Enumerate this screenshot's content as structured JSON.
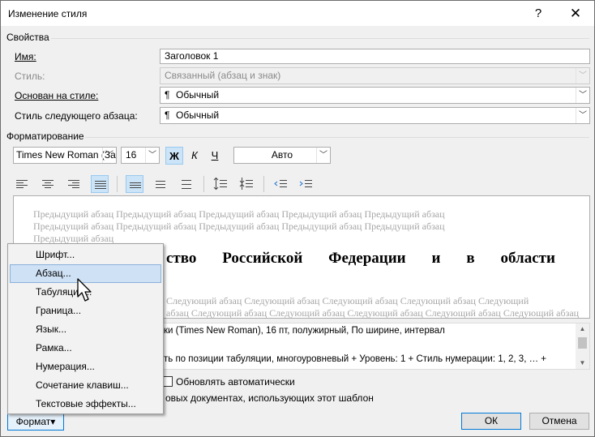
{
  "window": {
    "title": "Изменение стиля",
    "help_glyph": "?",
    "close_glyph": "✕"
  },
  "properties": {
    "section_label": "Свойства",
    "name_label": "Имя:",
    "name_value": "Заголовок 1",
    "style_label": "Стиль:",
    "style_value": "Связанный (абзац и знак)",
    "based_on_label": "Основан на стиле:",
    "based_on_value": "Обычный",
    "next_style_label": "Стиль следующего абзаца:",
    "next_style_value": "Обычный",
    "pilcrow": "¶"
  },
  "formatting": {
    "section_label": "Форматирование",
    "font_value": "Times New Roman (За",
    "size_value": "16",
    "bold": "Ж",
    "italic": "К",
    "underline": "Ч",
    "color_value": "Авто"
  },
  "preview": {
    "prev_line1": "Предыдущий абзац Предыдущий абзац Предыдущий абзац Предыдущий абзац Предыдущий абзац",
    "prev_line2": "Предыдущий абзац Предыдущий абзац Предыдущий абзац Предыдущий абзац Предыдущий абзац",
    "prev_line3": "Предыдущий абзац",
    "sample_words": [
      "ство",
      "Российской",
      "Федерации",
      "и",
      "в",
      "области"
    ],
    "next_line1": "Следующий абзац Следующий абзац Следующий абзац Следующий абзац Следующий",
    "next_line2": "абзац Следующий абзац Следующий абзац Следующий абзац Следующий абзац Следующий абзац"
  },
  "description": {
    "line1": "ки (Times New Roman), 16 пт, полужирный, По ширине, интервал",
    "line2": "ть по позиции табуляции, многоуровневый + Уровень: 1 + Стиль нумерации: 1, 2, 3, … +"
  },
  "options": {
    "auto_update_label": "Обновлять автоматически",
    "new_docs_label": "овых документах, использующих этот шаблон"
  },
  "buttons": {
    "format_label": "Формат",
    "format_arrow": "▾",
    "ok_label": "ОК",
    "cancel_label": "Отмена"
  },
  "format_menu": {
    "items": [
      "Шрифт...",
      "Абзац...",
      "Табуляция...",
      "Граница...",
      "Язык...",
      "Рамка...",
      "Нумерация...",
      "Сочетание клавиш...",
      "Текстовые эффекты..."
    ],
    "highlighted_index": 1
  },
  "colors": {
    "accent": "#0078d7",
    "highlight": "#cce4f7",
    "disabled_text": "#8a8a8a"
  }
}
